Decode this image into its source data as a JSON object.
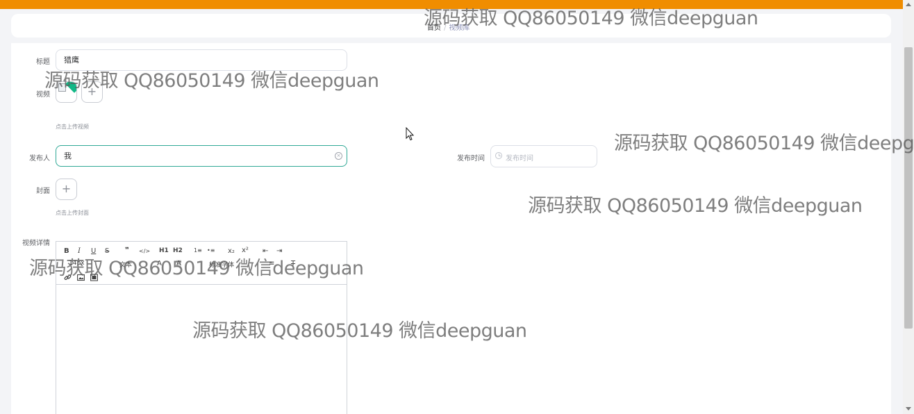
{
  "breadcrumb": {
    "home": "首页",
    "separator": "/",
    "current": "视频库"
  },
  "form": {
    "title_label": "标题",
    "title_value": "猎鹰",
    "video_label": "视频",
    "video_hint": "点击上传视频",
    "publisher_label": "发布人",
    "publisher_value": "我",
    "publish_time_label": "发布时间",
    "publish_time_placeholder": "发布时间",
    "cover_label": "封面",
    "cover_hint": "点击上传封面",
    "detail_label": "视频详情"
  },
  "editor": {
    "toolbar_row1": [
      "B",
      "I",
      "U",
      "S",
      "❞",
      "</>",
      "H1",
      "H2",
      "1≡",
      "•≡",
      "x₂",
      "x²",
      "⇤",
      "⇥"
    ],
    "toolbar_row2": [
      "14px",
      "文本",
      "A",
      "A",
      "标准字体",
      "≡",
      "T"
    ],
    "toolbar_row3": [
      "link-icon",
      "image-icon",
      "video-icon"
    ]
  },
  "upload_plus": "+",
  "clear_glyph": "×",
  "watermark": "源码获取 QQ86050149 微信deepguan",
  "colors": {
    "topbar": "#f08d00",
    "focus_border": "#2ea895",
    "thumb_badge": "#12b886"
  }
}
